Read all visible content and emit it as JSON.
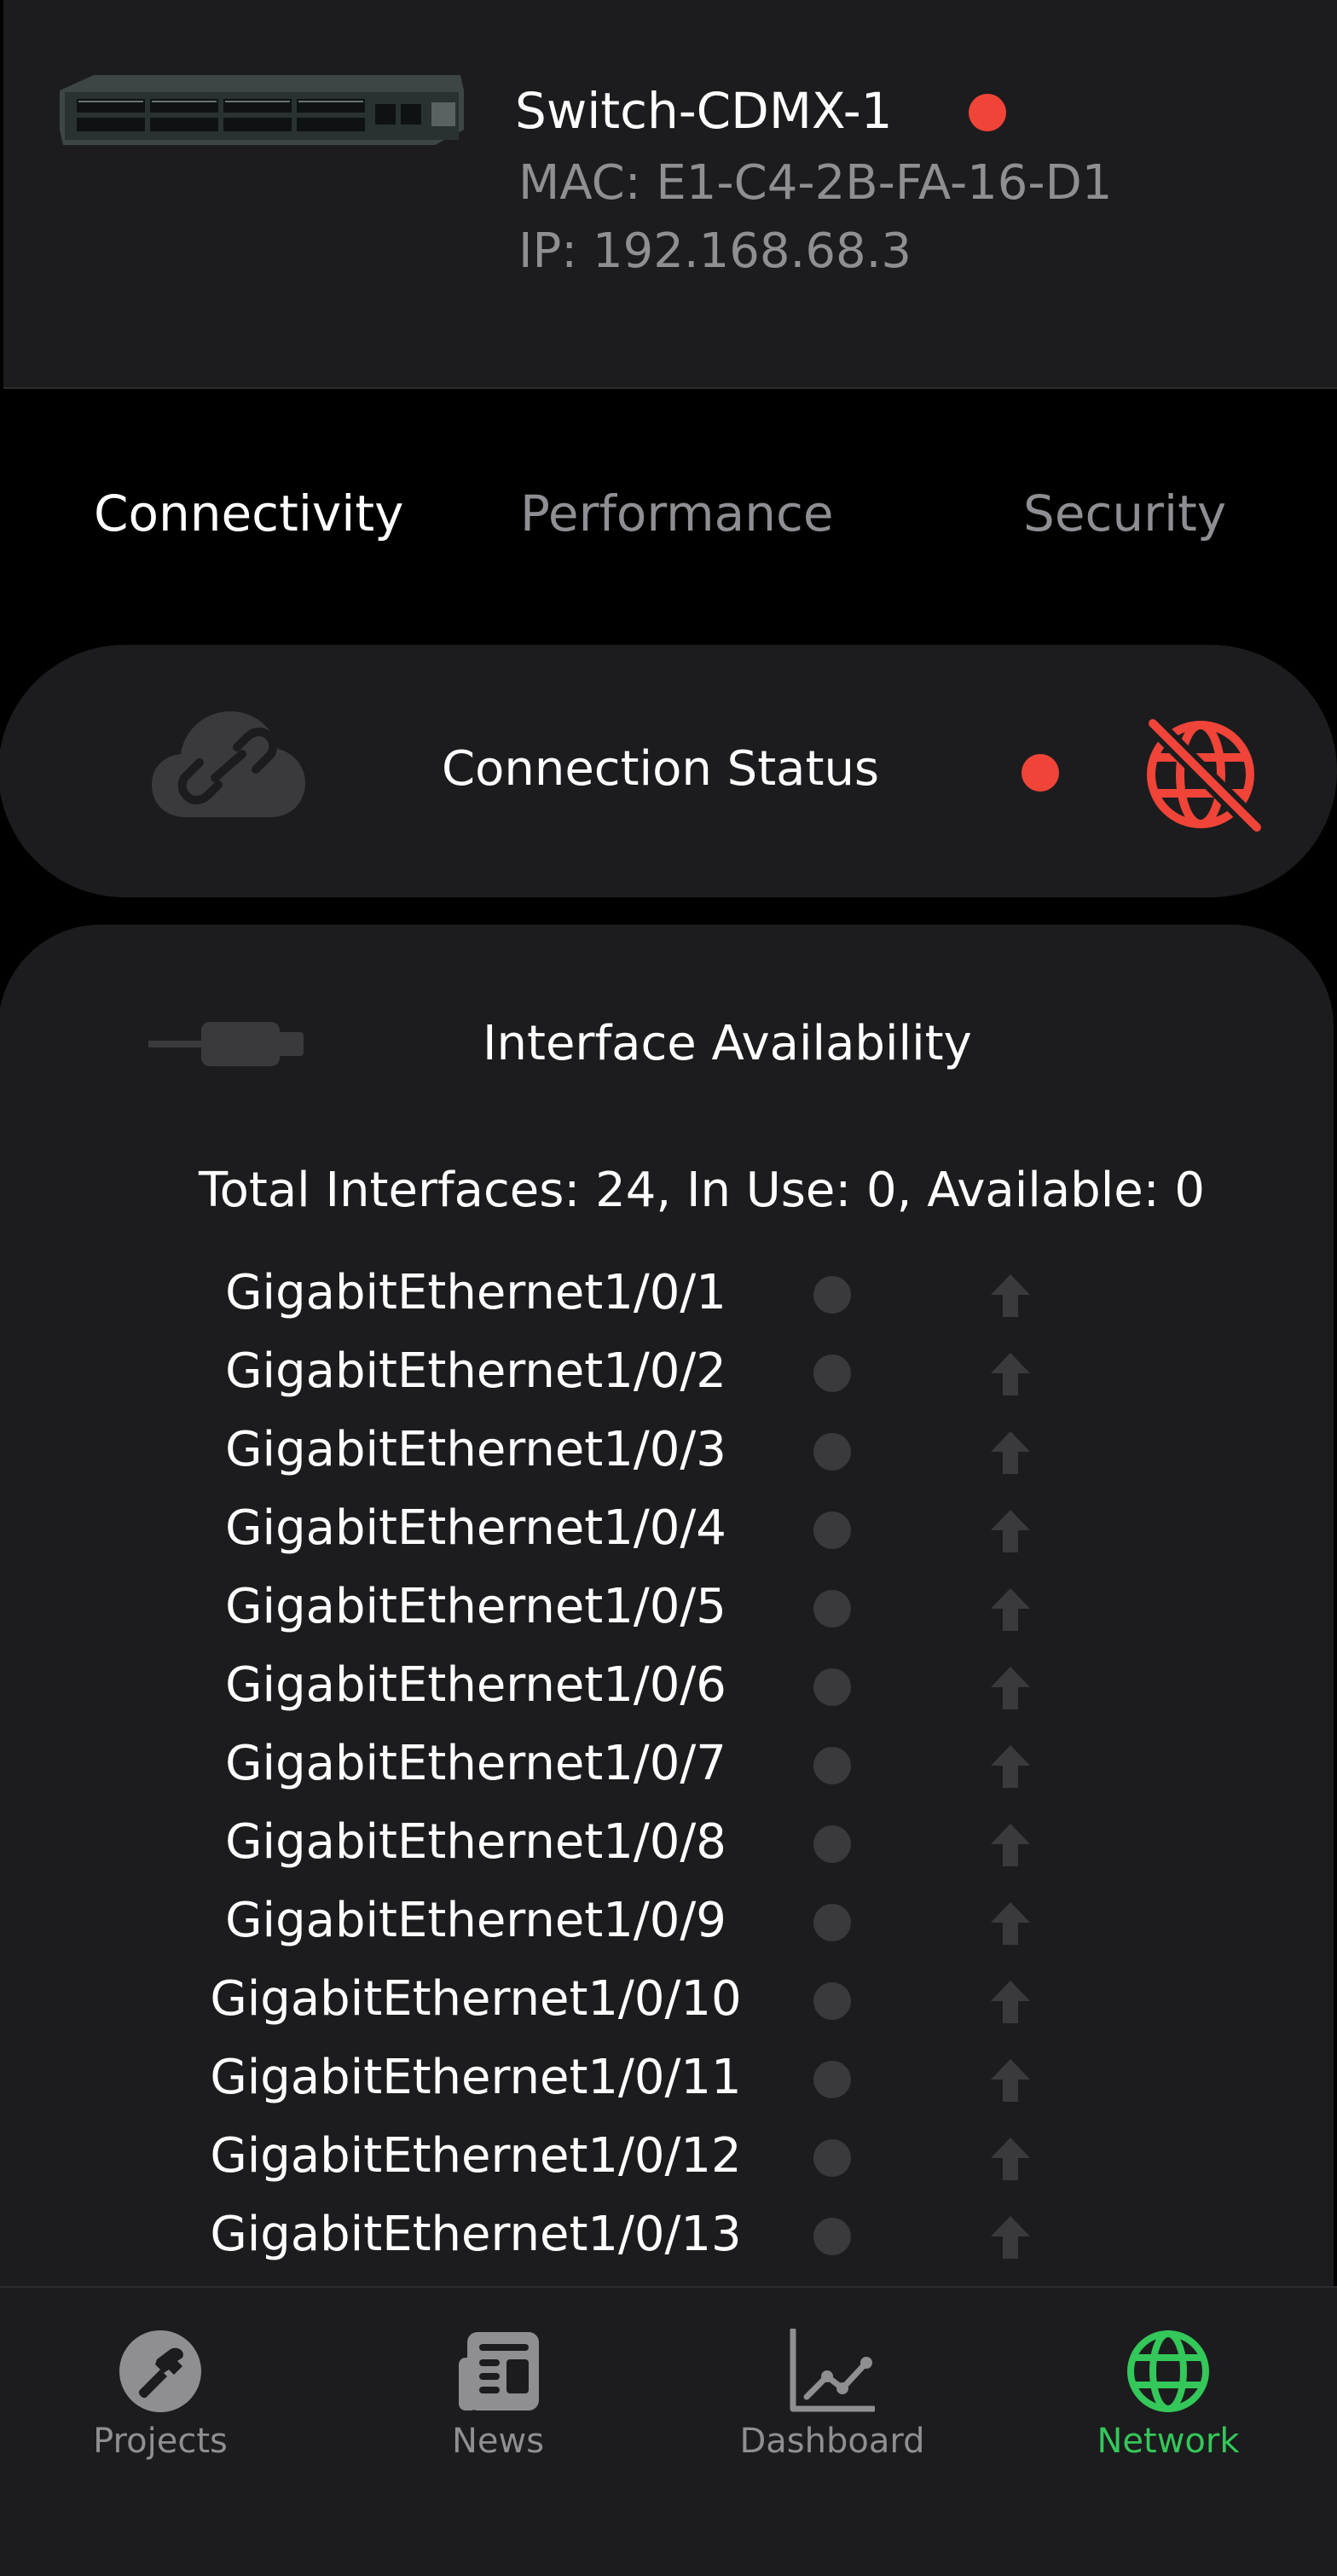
{
  "device": {
    "name": "Switch-CDMX-1",
    "mac": "MAC: E1-C4-2B-FA-16-D1",
    "ip": "IP: 192.168.68.3",
    "status_color": "#f04438"
  },
  "tabs": [
    {
      "label": "Connectivity",
      "active": true
    },
    {
      "label": "Performance",
      "active": false
    },
    {
      "label": "Security",
      "active": false
    }
  ],
  "connection": {
    "label": "Connection Status",
    "status_color": "#f04438",
    "icon_left": "cloud-link-icon",
    "icon_right": "globe-off-icon"
  },
  "interfaces": {
    "title": "Interface Availability",
    "summary": "Total Interfaces: 24, In Use: 0, Available: 0",
    "items": [
      "GigabitEthernet1/0/1",
      "GigabitEthernet1/0/2",
      "GigabitEthernet1/0/3",
      "GigabitEthernet1/0/4",
      "GigabitEthernet1/0/5",
      "GigabitEthernet1/0/6",
      "GigabitEthernet1/0/7",
      "GigabitEthernet1/0/8",
      "GigabitEthernet1/0/9",
      "GigabitEthernet1/0/10",
      "GigabitEthernet1/0/11",
      "GigabitEthernet1/0/12",
      "GigabitEthernet1/0/13"
    ]
  },
  "tabbar": {
    "items": [
      {
        "label": "Projects",
        "icon": "hammer-icon",
        "active": false
      },
      {
        "label": "News",
        "icon": "newspaper-icon",
        "active": false
      },
      {
        "label": "Dashboard",
        "icon": "chart-line-icon",
        "active": false
      },
      {
        "label": "Network",
        "icon": "globe-icon",
        "active": true
      }
    ]
  },
  "colors": {
    "accent_green": "#34c759",
    "alert_red": "#f04438",
    "muted_gray": "#8e8e93",
    "card_bg": "#1c1c1e"
  }
}
